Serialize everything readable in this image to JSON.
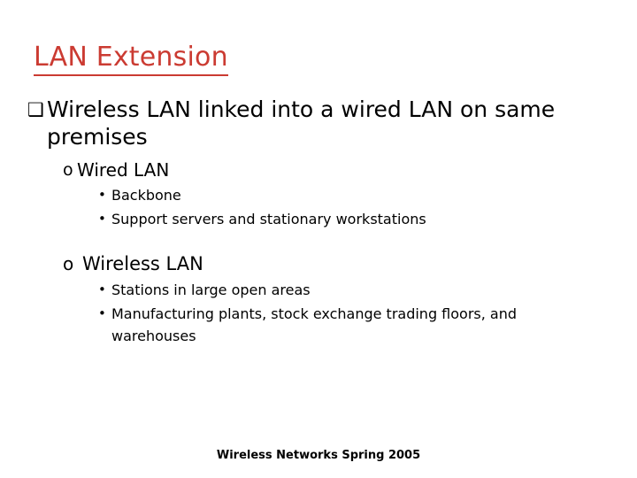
{
  "slide": {
    "title": "LAN Extension",
    "title_color": "#cb3b32",
    "background_color": "#ffffff",
    "text_color": "#000000"
  },
  "bullets": {
    "markers": {
      "level1": "❑",
      "level2": "o",
      "level3": "•"
    },
    "level1": [
      {
        "text": "Wireless LAN linked into a wired LAN on same premises"
      }
    ],
    "level2": [
      {
        "text": "Wired LAN"
      },
      {
        "text": "Wireless LAN"
      }
    ],
    "level3": [
      {
        "text": "Backbone"
      },
      {
        "text": "Support servers and stationary workstations"
      },
      {
        "text": "Stations in large open areas"
      },
      {
        "text": "Manufacturing plants, stock exchange trading floors, and warehouses"
      }
    ]
  },
  "footer": {
    "text": "Wireless Networks Spring 2005"
  }
}
